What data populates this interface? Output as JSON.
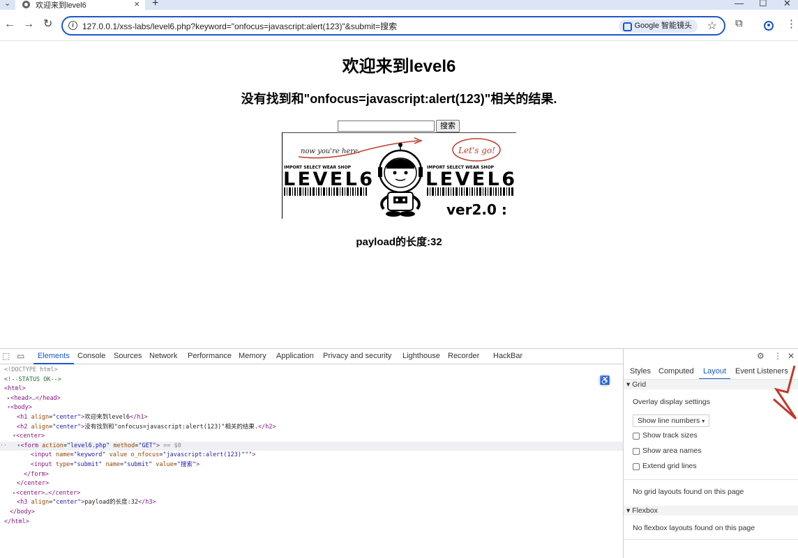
{
  "browser": {
    "tab_title": "欢迎来到level6",
    "tab_close": "×",
    "tab_menu": "⌄",
    "new_tab": "+",
    "url": "127.0.0.1/xss-labs/level6.php?keyword=\"onfocus=javascript:alert(123)\"&submit=搜索",
    "info_icon": "i",
    "lens_label": "Google 智能镜头",
    "star_icon": "☆",
    "win_min": "—",
    "win_max": "☐",
    "win_close": "✕",
    "back": "←",
    "forward": "→",
    "reload": "↻",
    "extensions": "⧉",
    "more": "⋮"
  },
  "page": {
    "h1": "欢迎来到level6",
    "h2": "没有找到和\"onfocus=javascript:alert(123)\"相关的结果.",
    "search_button": "搜索",
    "search_value": "",
    "h3": "payload的长度:32",
    "banner": {
      "now_text": "now you're here.",
      "go_text": "Let's go!",
      "shop_text": "IMPORT SELECT WEAR SHOP",
      "level_text": "LEVEL6",
      "ver_text": "ver2.0 :"
    }
  },
  "devtools": {
    "tabs": [
      "Elements",
      "Console",
      "Sources",
      "Network",
      "Performance",
      "Memory",
      "Application",
      "Privacy and security",
      "Lighthouse",
      "Recorder",
      "HackBar"
    ],
    "active_tab": "Elements",
    "side_tabs": [
      "Styles",
      "Computed",
      "Layout",
      "Event Listeners"
    ],
    "active_side_tab": "Layout",
    "code": {
      "l1": "<!DOCTYPE html>",
      "l2": "<!--STATUS OK-->",
      "l3_tag": "<html>",
      "l4_open": "<head>",
      "l4_dots": "…",
      "l4_close": "</head>",
      "l5": "<body>",
      "l6_open": "<h1 ",
      "l6_attr": "align",
      "l6_val": "\"center\"",
      "l6_text": "欢迎来到level6",
      "l6_close": "</h1>",
      "l7_open": "<h2 ",
      "l7_attr": "align",
      "l7_val": "\"center\"",
      "l7_text": "没有找到和\"onfocus=javascript:alert(123)\"相关的结果.",
      "l7_close": "</h2>",
      "l8": "<center>",
      "l9_open": "<form ",
      "l9_a1": "action",
      "l9_v1": "\"level6.php\"",
      "l9_a2": "method",
      "l9_v2": "\"GET\"",
      "l9_end": ">",
      "l9_eq": " == $0",
      "l10_open": "<input ",
      "l10_a1": "name",
      "l10_v1": "\"keyword\"",
      "l10_a2": "value",
      "l10_a3": "o_nfocus",
      "l10_v3": "\"javascript:alert(123)\"\"\"",
      "l10_end": ">",
      "l11_open": "<input ",
      "l11_a1": "type",
      "l11_v1": "\"submit\"",
      "l11_a2": "name",
      "l11_v2": "\"submit\"",
      "l11_a3": "value",
      "l11_v3": "\"搜索\"",
      "l11_end": ">",
      "l12": "</form>",
      "l13": "</center>",
      "l14_open": "<center>",
      "l14_dots": "…",
      "l14_close": "</center>",
      "l15_open": "<h3 ",
      "l15_attr": "align",
      "l15_val": "\"center\"",
      "l15_text": "payload的长度:32",
      "l15_close": "</h3>",
      "l16": "</body>",
      "l17": "</html>"
    },
    "layout_panel": {
      "grid_header": "Grid",
      "overlay_settings": "Overlay display settings",
      "select_value": "Show line numbers",
      "checkboxes": [
        "Show track sizes",
        "Show area names",
        "Extend grid lines"
      ],
      "no_grid": "No grid layouts found on this page",
      "flexbox_header": "Flexbox",
      "no_flexbox": "No flexbox layouts found on this page"
    }
  }
}
